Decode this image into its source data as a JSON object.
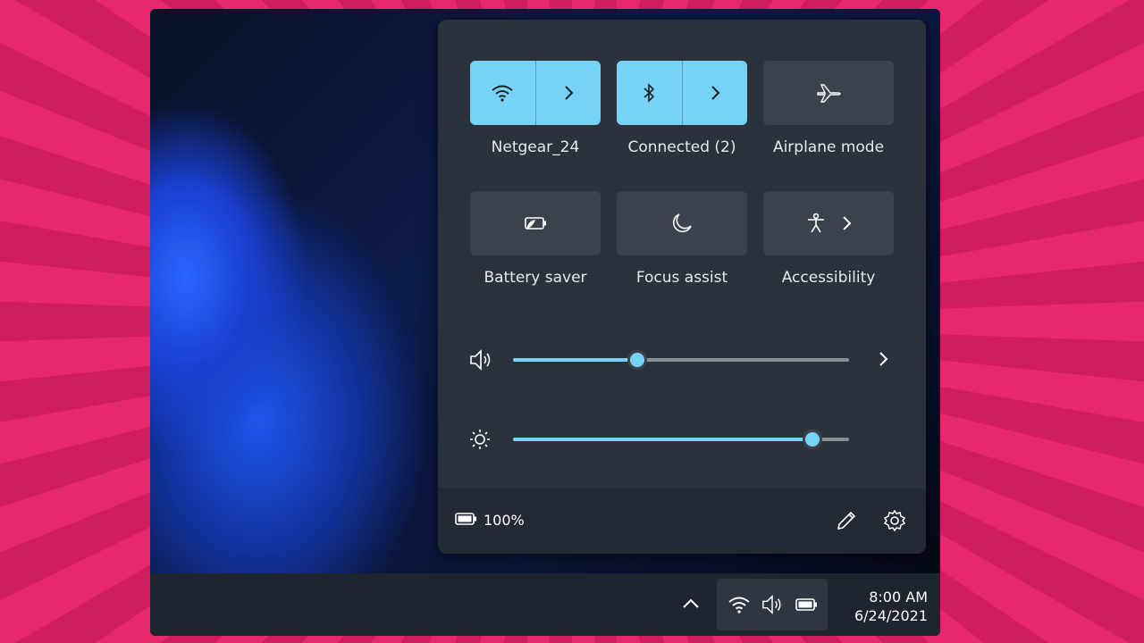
{
  "quick_settings": {
    "tiles": [
      {
        "label": "Netgear_24",
        "icon": "wifi-icon",
        "active": true,
        "expandable": true
      },
      {
        "label": "Connected (2)",
        "icon": "bluetooth-icon",
        "active": true,
        "expandable": true
      },
      {
        "label": "Airplane mode",
        "icon": "airplane-icon",
        "active": false,
        "expandable": false
      },
      {
        "label": "Battery saver",
        "icon": "battery-saver-icon",
        "active": false,
        "expandable": false
      },
      {
        "label": "Focus assist",
        "icon": "moon-icon",
        "active": false,
        "expandable": false
      },
      {
        "label": "Accessibility",
        "icon": "accessibility-icon",
        "active": false,
        "expandable": true
      }
    ],
    "volume": {
      "icon": "speaker-icon",
      "level_percent": 37
    },
    "brightness": {
      "icon": "brightness-icon",
      "level_percent": 89
    },
    "battery": {
      "icon": "battery-icon",
      "text": "100%"
    },
    "footer_icons": [
      "pencil-icon",
      "gear-icon"
    ]
  },
  "taskbar": {
    "tray_icons": [
      "chevron-up-icon",
      "wifi-icon",
      "speaker-icon",
      "battery-icon"
    ],
    "time": "8:00 AM",
    "date": "6/24/2021"
  },
  "colors": {
    "accent": "#76d3f7",
    "panel": "#2a323c",
    "tile_off": "#3a424c",
    "taskbar": "#1e252e",
    "background": "#e8286e"
  }
}
